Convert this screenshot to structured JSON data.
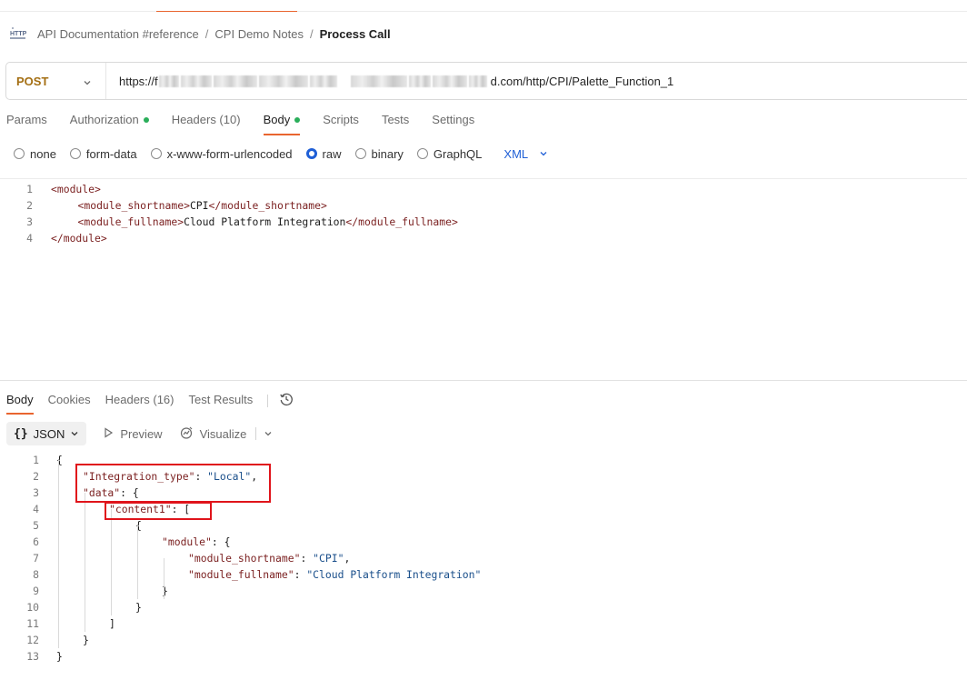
{
  "breadcrumb": {
    "icon": "http-icon",
    "items": [
      "API Documentation #reference",
      "CPI Demo Notes"
    ],
    "separator": "/",
    "current": "Process Call"
  },
  "request": {
    "method": "POST",
    "url_prefix": "https://f",
    "url_suffix": "d.com/http/CPI/Palette_Function_1",
    "tabs": [
      {
        "label": "Params",
        "dot": false
      },
      {
        "label": "Authorization",
        "dot": true
      },
      {
        "label": "Headers (10)",
        "dot": false
      },
      {
        "label": "Body",
        "dot": true,
        "active": true
      },
      {
        "label": "Scripts",
        "dot": false
      },
      {
        "label": "Tests",
        "dot": false
      },
      {
        "label": "Settings",
        "dot": false
      }
    ],
    "body_types": [
      "none",
      "form-data",
      "x-www-form-urlencoded",
      "raw",
      "binary",
      "GraphQL"
    ],
    "selected_body_type": "raw",
    "format": "XML",
    "body_lines": [
      {
        "num": "1",
        "indent": 0,
        "parts": [
          {
            "t": "tag",
            "v": "<module>"
          }
        ]
      },
      {
        "num": "2",
        "indent": 1,
        "parts": [
          {
            "t": "tag",
            "v": "<module_shortname>"
          },
          {
            "t": "val",
            "v": "CPI"
          },
          {
            "t": "tag",
            "v": "</module_shortname>"
          }
        ]
      },
      {
        "num": "3",
        "indent": 1,
        "parts": [
          {
            "t": "tag",
            "v": "<module_fullname>"
          },
          {
            "t": "val",
            "v": "Cloud Platform Integration"
          },
          {
            "t": "tag",
            "v": "</module_fullname>"
          }
        ]
      },
      {
        "num": "4",
        "indent": 0,
        "parts": [
          {
            "t": "tag",
            "v": "</module>"
          }
        ]
      }
    ]
  },
  "response": {
    "tabs": [
      "Body",
      "Cookies",
      "Headers (16)",
      "Test Results"
    ],
    "active_tab": "Body",
    "format": "JSON",
    "preview_label": "Preview",
    "visualize_label": "Visualize",
    "body_lines": [
      {
        "num": "1",
        "indent": 0,
        "parts": [
          {
            "t": "jpunc",
            "v": "{"
          }
        ]
      },
      {
        "num": "2",
        "indent": 1,
        "parts": [
          {
            "t": "jkey",
            "v": "\"Integration_type\""
          },
          {
            "t": "jpunc",
            "v": ": "
          },
          {
            "t": "jstr",
            "v": "\"Local\""
          },
          {
            "t": "jpunc",
            "v": ","
          }
        ]
      },
      {
        "num": "3",
        "indent": 1,
        "parts": [
          {
            "t": "jkey",
            "v": "\"data\""
          },
          {
            "t": "jpunc",
            "v": ": {"
          }
        ]
      },
      {
        "num": "4",
        "indent": 2,
        "parts": [
          {
            "t": "jkey",
            "v": "\"content1\""
          },
          {
            "t": "jpunc",
            "v": ": ["
          }
        ]
      },
      {
        "num": "5",
        "indent": 3,
        "parts": [
          {
            "t": "jpunc",
            "v": "{"
          }
        ]
      },
      {
        "num": "6",
        "indent": 4,
        "parts": [
          {
            "t": "jkey",
            "v": "\"module\""
          },
          {
            "t": "jpunc",
            "v": ": {"
          }
        ]
      },
      {
        "num": "7",
        "indent": 5,
        "parts": [
          {
            "t": "jkey",
            "v": "\"module_shortname\""
          },
          {
            "t": "jpunc",
            "v": ": "
          },
          {
            "t": "jstr",
            "v": "\"CPI\""
          },
          {
            "t": "jpunc",
            "v": ","
          }
        ]
      },
      {
        "num": "8",
        "indent": 5,
        "parts": [
          {
            "t": "jkey",
            "v": "\"module_fullname\""
          },
          {
            "t": "jpunc",
            "v": ": "
          },
          {
            "t": "jstr",
            "v": "\"Cloud Platform Integration\""
          }
        ]
      },
      {
        "num": "9",
        "indent": 4,
        "parts": [
          {
            "t": "jpunc",
            "v": "}"
          }
        ]
      },
      {
        "num": "10",
        "indent": 3,
        "parts": [
          {
            "t": "jpunc",
            "v": "}"
          }
        ]
      },
      {
        "num": "11",
        "indent": 2,
        "parts": [
          {
            "t": "jpunc",
            "v": "]"
          }
        ]
      },
      {
        "num": "12",
        "indent": 1,
        "parts": [
          {
            "t": "jpunc",
            "v": "}"
          }
        ]
      },
      {
        "num": "13",
        "indent": 0,
        "parts": [
          {
            "t": "jpunc",
            "v": "}"
          }
        ]
      }
    ]
  },
  "colors": {
    "accent": "#e9652f",
    "method_post": "#a46f13",
    "link_blue": "#1f5fd6",
    "status_dot": "#2aae5a",
    "highlight_box": "#e0141b"
  }
}
